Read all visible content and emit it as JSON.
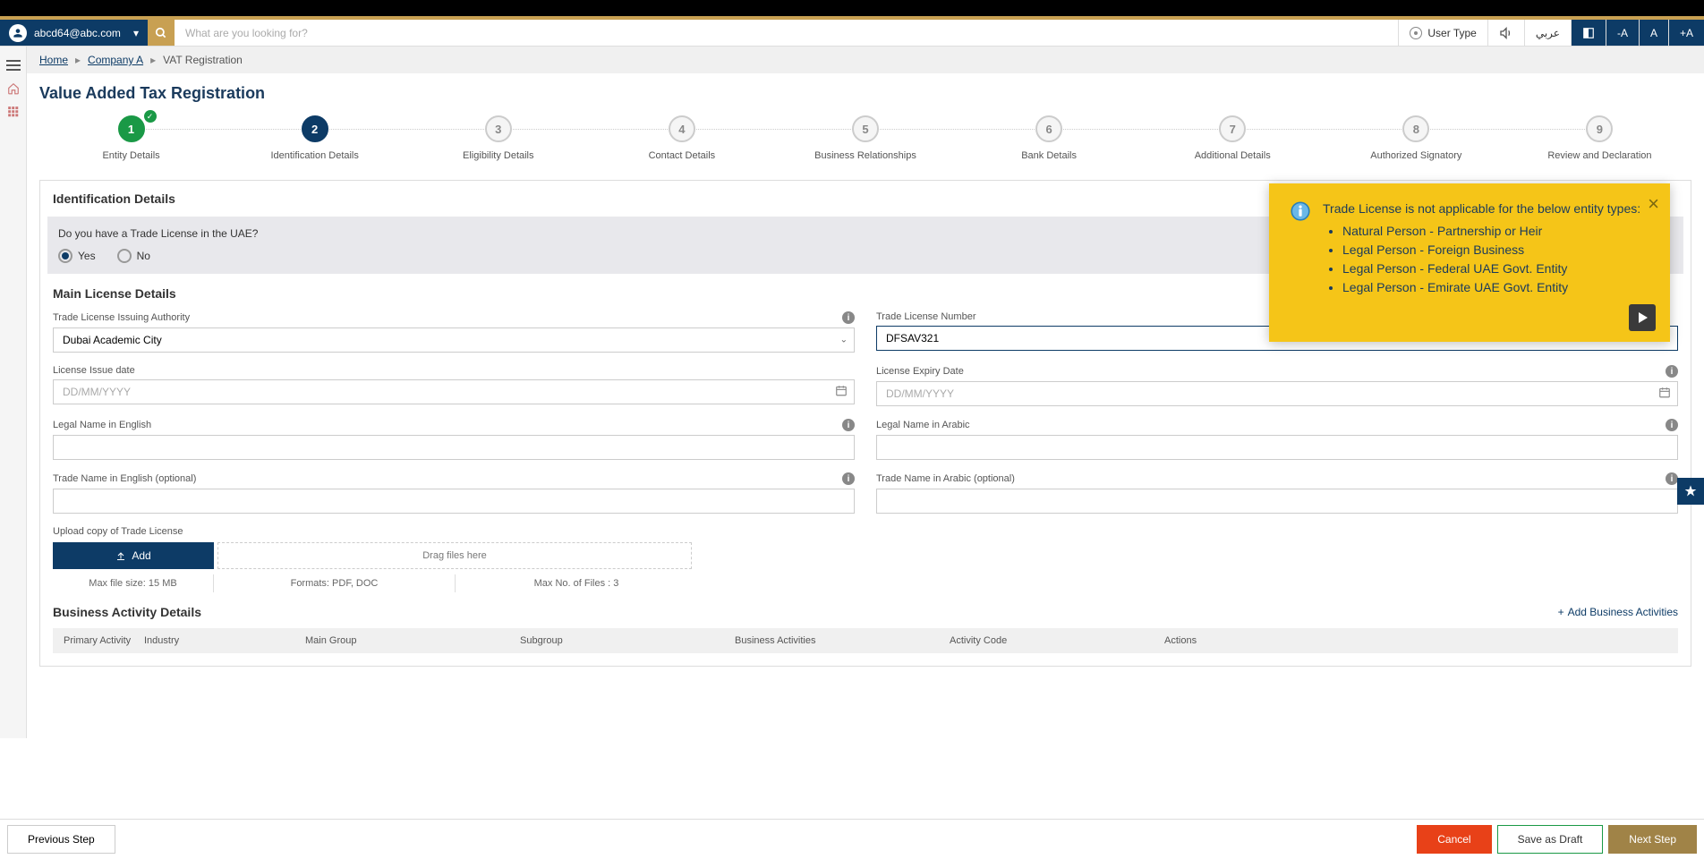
{
  "topbar": {
    "user_email": "abcd64@abc.com",
    "search_placeholder": "What are you looking for?",
    "user_type_label": "User Type",
    "lang_label": "عربي",
    "a_minus": "-A",
    "a_normal": "A",
    "a_plus": "+A"
  },
  "breadcrumb": {
    "home": "Home",
    "company": "Company A",
    "current": "VAT Registration"
  },
  "page_title": "Value Added Tax Registration",
  "steps": [
    {
      "num": "1",
      "label": "Entity Details"
    },
    {
      "num": "2",
      "label": "Identification Details"
    },
    {
      "num": "3",
      "label": "Eligibility Details"
    },
    {
      "num": "4",
      "label": "Contact Details"
    },
    {
      "num": "5",
      "label": "Business Relationships"
    },
    {
      "num": "6",
      "label": "Bank Details"
    },
    {
      "num": "7",
      "label": "Additional Details"
    },
    {
      "num": "8",
      "label": "Authorized Signatory"
    },
    {
      "num": "9",
      "label": "Review and Declaration"
    }
  ],
  "section": {
    "identification_title": "Identification Details",
    "question": "Do you have a Trade License in the UAE?",
    "yes": "Yes",
    "no": "No",
    "main_license_title": "Main License Details"
  },
  "fields": {
    "issuing_authority_label": "Trade License Issuing Authority",
    "issuing_authority_value": "Dubai Academic City",
    "license_number_label": "Trade License Number",
    "license_number_value": "DFSAV321",
    "issue_date_label": "License Issue date",
    "issue_date_placeholder": "DD/MM/YYYY",
    "expiry_date_label": "License Expiry Date",
    "expiry_date_placeholder": "DD/MM/YYYY",
    "legal_en_label": "Legal Name in English",
    "legal_ar_label": "Legal Name in Arabic",
    "trade_en_label": "Trade Name in English (optional)",
    "trade_ar_label": "Trade Name in Arabic (optional)"
  },
  "upload": {
    "label": "Upload copy of Trade License",
    "add_btn": "Add",
    "drag_text": "Drag files here",
    "max_size": "Max file size: 15 MB",
    "formats": "Formats: PDF, DOC",
    "max_count": "Max No. of Files : 3"
  },
  "biz_activity": {
    "title": "Business Activity Details",
    "add_link": "Add Business Activities",
    "headers": {
      "primary": "Primary Activity",
      "industry": "Industry",
      "main_group": "Main Group",
      "subgroup": "Subgroup",
      "activities": "Business Activities",
      "code": "Activity Code",
      "actions": "Actions"
    }
  },
  "tooltip": {
    "lead": "Trade License is not applicable for the below entity types:",
    "items": [
      "Natural Person - Partnership or Heir",
      "Legal Person - Foreign Business",
      "Legal Person - Federal UAE Govt. Entity",
      "Legal Person - Emirate UAE Govt. Entity"
    ]
  },
  "footer": {
    "prev": "Previous Step",
    "cancel": "Cancel",
    "draft": "Save as Draft",
    "next": "Next Step"
  }
}
